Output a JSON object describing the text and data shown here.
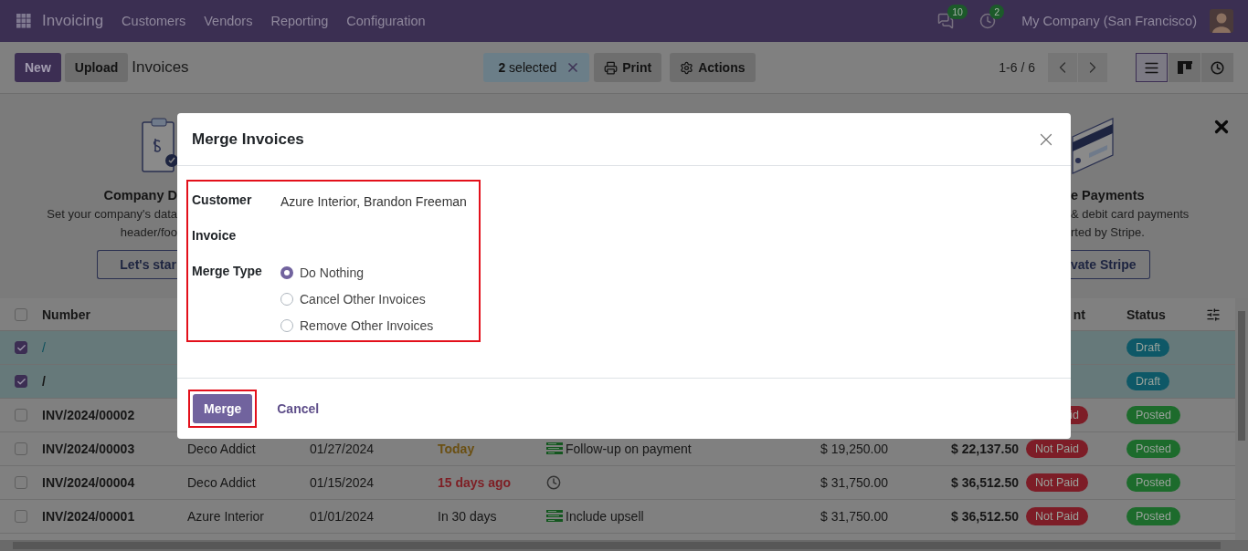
{
  "navbar": {
    "app": "Invoicing",
    "menu": [
      "Customers",
      "Vendors",
      "Reporting",
      "Configuration"
    ],
    "systray": [
      {
        "kind": "messages",
        "count": "10"
      },
      {
        "kind": "activity",
        "count": "2"
      }
    ],
    "company": "My Company (San Francisco)"
  },
  "control_panel": {
    "buttons": [
      {
        "label": "New",
        "kind": "primary"
      },
      {
        "label": "Upload",
        "kind": "secondary"
      }
    ],
    "title": "Invoices",
    "selection": "**2** selected",
    "actions": [
      {
        "label": "Print",
        "kind": "print"
      },
      {
        "label": "Actions",
        "kind": "gear"
      }
    ],
    "pager": "1-6 / 6",
    "views": [
      {
        "kind": "list",
        "selected": true
      },
      {
        "kind": "kanban",
        "selected": false
      },
      {
        "kind": "activity",
        "selected": false
      }
    ]
  },
  "banner": {
    "left": {
      "title": "Company D",
      "lines": [
        "Set your company's data",
        "header/foo"
      ],
      "button": "Let's star"
    },
    "right": {
      "title": "e Payments",
      "lines": [
        "& debit card payments",
        "rted by Stripe."
      ],
      "button": "vate Stripe"
    }
  },
  "table": {
    "header": {
      "checked": false,
      "number": "Number",
      "payment": "nt",
      "status": "Status"
    },
    "rows": [
      {
        "selected": true,
        "number": "/",
        "draft": true,
        "status": {
          "label": "Draft",
          "kind": "draft"
        }
      },
      {
        "selected": true,
        "number": "/",
        "draft": false,
        "status": {
          "label": "Draft",
          "kind": "draft"
        }
      },
      {
        "selected": false,
        "number": "INV/2024/00002",
        "payment": {
          "label": "id",
          "kind": "not_paid"
        },
        "status": {
          "label": "Posted",
          "kind": "posted"
        }
      },
      {
        "selected": false,
        "number": "INV/2024/00003",
        "customer": "Deco Addict",
        "date": "01/27/2024",
        "due": {
          "label": "Today",
          "kind": "today"
        },
        "activity": {
          "kind": "todo",
          "label": "Follow-up on payment"
        },
        "untaxed": "$ 19,250.00",
        "total": "$ 22,137.50",
        "payment": {
          "label": "Not Paid",
          "kind": "not_paid"
        },
        "status": {
          "label": "Posted",
          "kind": "posted"
        }
      },
      {
        "selected": false,
        "number": "INV/2024/00004",
        "customer": "Deco Addict",
        "date": "01/15/2024",
        "due": {
          "label": "15 days ago",
          "kind": "overdue"
        },
        "activity": {
          "kind": "clock"
        },
        "untaxed": "$ 31,750.00",
        "total": "$ 36,512.50",
        "payment": {
          "label": "Not Paid",
          "kind": "not_paid"
        },
        "status": {
          "label": "Posted",
          "kind": "posted"
        }
      },
      {
        "selected": false,
        "number": "INV/2024/00001",
        "customer": "Azure Interior",
        "date": "01/01/2024",
        "due": {
          "label": "In 30 days",
          "kind": "future"
        },
        "activity": {
          "kind": "todo",
          "label": "Include upsell"
        },
        "untaxed": "$ 31,750.00",
        "total": "$ 36,512.50",
        "payment": {
          "label": "Not Paid",
          "kind": "not_paid"
        },
        "status": {
          "label": "Posted",
          "kind": "posted"
        }
      }
    ]
  },
  "dialog": {
    "title": "Merge Invoices",
    "fields": [
      {
        "label": "Customer",
        "kind": "text",
        "value": "Azure Interior, Brandon Freeman"
      },
      {
        "label": "Invoice",
        "kind": "empty"
      },
      {
        "label": "Merge Type",
        "kind": "radio",
        "options": [
          {
            "label": "Do Nothing",
            "selected": true
          },
          {
            "label": "Cancel Other Invoices",
            "selected": false
          },
          {
            "label": "Remove Other Invoices",
            "selected": false
          }
        ]
      }
    ],
    "buttons": [
      {
        "label": "Merge",
        "kind": "primary"
      },
      {
        "label": "Cancel",
        "kind": "link"
      }
    ]
  }
}
